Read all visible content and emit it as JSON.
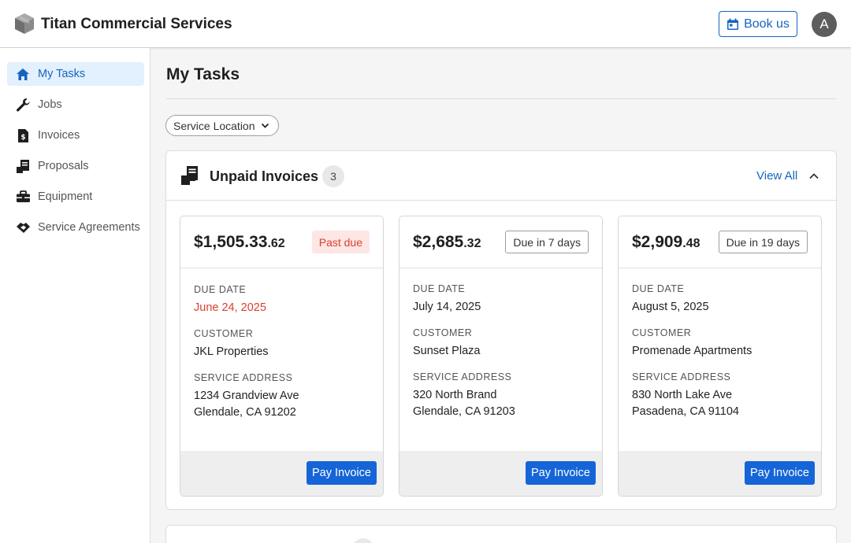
{
  "header": {
    "brand": "Titan Commercial Services",
    "book_label": "Book us",
    "avatar_initial": "A"
  },
  "sidebar": {
    "items": [
      {
        "label": "My Tasks",
        "icon": "home-icon",
        "active": true
      },
      {
        "label": "Jobs",
        "icon": "wrench-icon"
      },
      {
        "label": "Invoices",
        "icon": "invoice-icon"
      },
      {
        "label": "Proposals",
        "icon": "proposals-icon"
      },
      {
        "label": "Equipment",
        "icon": "toolbox-icon"
      },
      {
        "label": "Service Agreements",
        "icon": "handshake-icon"
      }
    ]
  },
  "main": {
    "title": "My Tasks",
    "filter_label": "Service Location",
    "section": {
      "title": "Unpaid Invoices",
      "count": "3",
      "view_all": "View All"
    },
    "labels": {
      "due_date": "DUE DATE",
      "customer": "CUSTOMER",
      "service_address": "SERVICE ADDRESS",
      "pay": "Pay Invoice"
    },
    "invoices": [
      {
        "amount_main": "$1,505.33",
        "amount_cents": ".62",
        "status": "Past due",
        "due_date": "June 24, 2025",
        "customer": "JKL Properties",
        "address_line1": "1234 Grandview Ave",
        "address_line2": "Glendale, CA 91202"
      },
      {
        "amount_main": "$2,685",
        "amount_cents": ".32",
        "status": "Due in 7 days",
        "due_date": "July 14, 2025",
        "customer": "Sunset Plaza",
        "address_line1": "320 North Brand",
        "address_line2": "Glendale, CA 91203"
      },
      {
        "amount_main": "$2,909",
        "amount_cents": ".48",
        "status": "Due in 19 days",
        "due_date": "August 5, 2025",
        "customer": "Promenade Apartments",
        "address_line1": "830 North Lake Ave",
        "address_line2": "Pasadena, CA 91104"
      }
    ]
  },
  "colors": {
    "accent": "#1565c0",
    "pay_button": "#1565d8",
    "past_due_text": "#d9412f",
    "past_due_bg": "#fde6e4",
    "active_nav_bg": "#e3f0fd"
  }
}
